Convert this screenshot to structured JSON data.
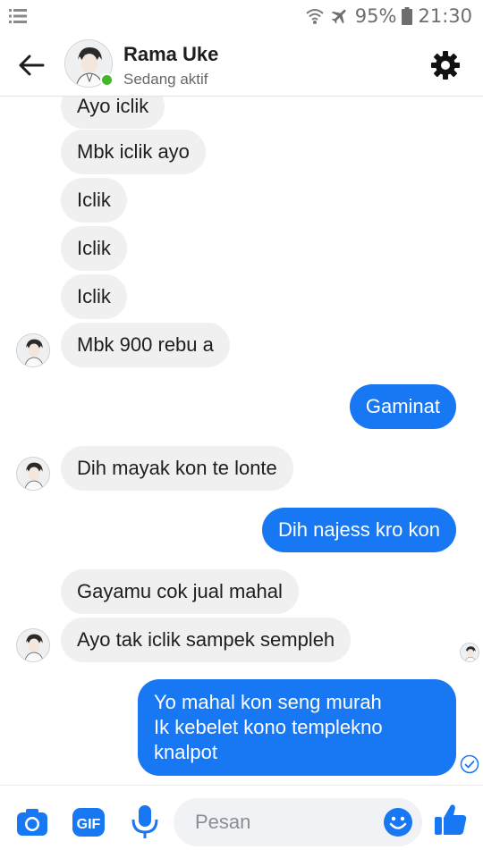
{
  "status_bar": {
    "battery": "95%",
    "time": "21:30"
  },
  "header": {
    "name": "Rama Uke",
    "status": "Sedang aktif"
  },
  "messages": [
    {
      "side": "in",
      "text": "Ayo iclik"
    },
    {
      "side": "in",
      "text": "Mbk iclik ayo"
    },
    {
      "side": "in",
      "text": "Iclik"
    },
    {
      "side": "in",
      "text": "Iclik"
    },
    {
      "side": "in",
      "text": "Iclik"
    },
    {
      "side": "in",
      "text": "Mbk 900 rebu a"
    },
    {
      "side": "out",
      "text": "Gaminat"
    },
    {
      "side": "in",
      "text": "Dih mayak kon te lonte"
    },
    {
      "side": "out",
      "text": "Dih najess kro kon"
    },
    {
      "side": "in",
      "text": "Gayamu cok jual mahal"
    },
    {
      "side": "in",
      "text": "Ayo tak iclik sampek sempleh"
    },
    {
      "side": "out",
      "lines": [
        "Yo mahal kon seng murah",
        "Ik kebelet kono templekno",
        "knalpot"
      ]
    }
  ],
  "composer": {
    "placeholder": "Pesan"
  },
  "colors": {
    "accent": "#1877f2",
    "incoming_bubble": "#f0f0f0",
    "online": "#42b72a"
  },
  "icons": [
    "menu-icon",
    "wifi-icon",
    "airplane-icon",
    "battery-icon",
    "back-arrow-icon",
    "gear-icon",
    "camera-icon",
    "gif-icon",
    "microphone-icon",
    "emoji-icon",
    "thumbs-up-icon",
    "delivered-check-icon"
  ]
}
